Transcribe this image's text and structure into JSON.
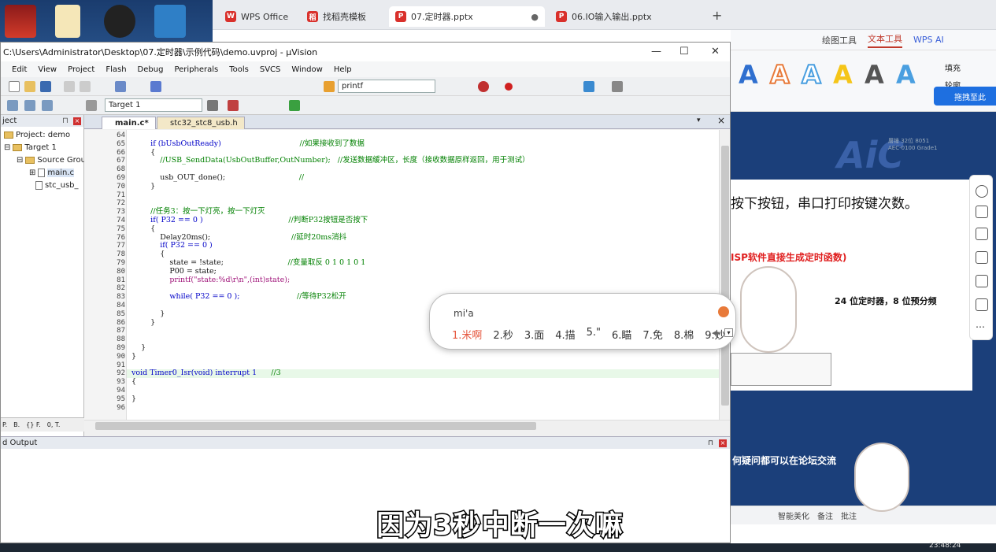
{
  "wps": {
    "tabs": [
      {
        "label": "WPS Office",
        "active": false
      },
      {
        "label": "找稻壳模板",
        "active": false
      },
      {
        "label": "07.定时器.pptx",
        "active": true
      },
      {
        "label": "06.IO输入输出.pptx",
        "active": false
      }
    ],
    "menu": [
      "绘图工具",
      "文本工具",
      "WPS AI"
    ],
    "ribbon_side": [
      "填充",
      "轮廓"
    ],
    "drag_hint": "拖拽至此",
    "slide": {
      "watermark": "AiC",
      "badge_line1": "屠锤 32位 8051",
      "badge_line2": "AEC-0100 Grade1",
      "heading": "按下按钮，串口打印按键次数。",
      "red_text": "ISP软件直接生成定时函数)",
      "bold_text": "24 位定时器，8 位预分频",
      "forum_text": "何疑问都可以在论坛交流"
    },
    "status": [
      "智能美化",
      "备注",
      "批注"
    ]
  },
  "keil": {
    "title": "C:\\Users\\Administrator\\Desktop\\07.定时器\\示例代码\\demo.uvproj - µVision",
    "menu": [
      "Edit",
      "View",
      "Project",
      "Flash",
      "Debug",
      "Peripherals",
      "Tools",
      "SVCS",
      "Window",
      "Help"
    ],
    "toolbar_combo": "printf",
    "target_combo": "Target 1",
    "project_panel_title": "ject",
    "tree": [
      "Project: demo",
      "Target 1",
      "Source Grou",
      "main.c",
      "stc_usb_"
    ],
    "editor_tabs": [
      "main.c*",
      "stc32_stc8_usb.h"
    ],
    "line_numbers": [
      "64",
      "65",
      "66",
      "67",
      "68",
      "69",
      "70",
      "71",
      "72",
      "73",
      "74",
      "75",
      "76",
      "77",
      "78",
      "79",
      "80",
      "81",
      "82",
      "83",
      "84",
      "85",
      "86",
      "87",
      "88",
      "89",
      "90",
      "91",
      "92",
      "93",
      "94",
      "95",
      "96"
    ],
    "code_lines": [
      "",
      "        if (bUsbOutReady)                                 //如果接收到了数据",
      "        {",
      "            //USB_SendData(UsbOutBuffer,OutNumber);   //发送数据缓冲区，长度（接收数据原样返回，用于测试）",
      "",
      "            usb_OUT_done();                               //",
      "        }",
      "",
      "",
      "        //任务3：按一下灯亮，按一下灯灭",
      "        if( P32 == 0 )                                    //判断P32按钮是否按下",
      "        {",
      "            Delay20ms();                                  //延时20ms消抖",
      "            if( P32 == 0 )",
      "            {",
      "                state = !state;                           //变量取反 0 1 0 1 0 1",
      "                P00 = state;",
      "                printf(\"state:%d\\r\\n\",(int)state);",
      "",
      "                while( P32 == 0 );                        //等待P32松开",
      "",
      "            }",
      "        }",
      "",
      "",
      "    }",
      "}",
      "",
      "void Timer0_Isr(void) interrupt 1      //3",
      "{",
      "",
      "}",
      ""
    ],
    "build_output_title": "d Output",
    "proj_tabs": [
      "P.",
      "B.",
      "{} F.",
      "0, T."
    ]
  },
  "ime": {
    "input": "mi'a",
    "candidates": [
      "1.米啊",
      "2.秒",
      "3.面",
      "4.描",
      "5.\"",
      "6.瞄",
      "7.免",
      "8.棉",
      "9.妙"
    ]
  },
  "subtitle": "因为3秒中断一次嘛",
  "taskbar_time": "23:48:24"
}
